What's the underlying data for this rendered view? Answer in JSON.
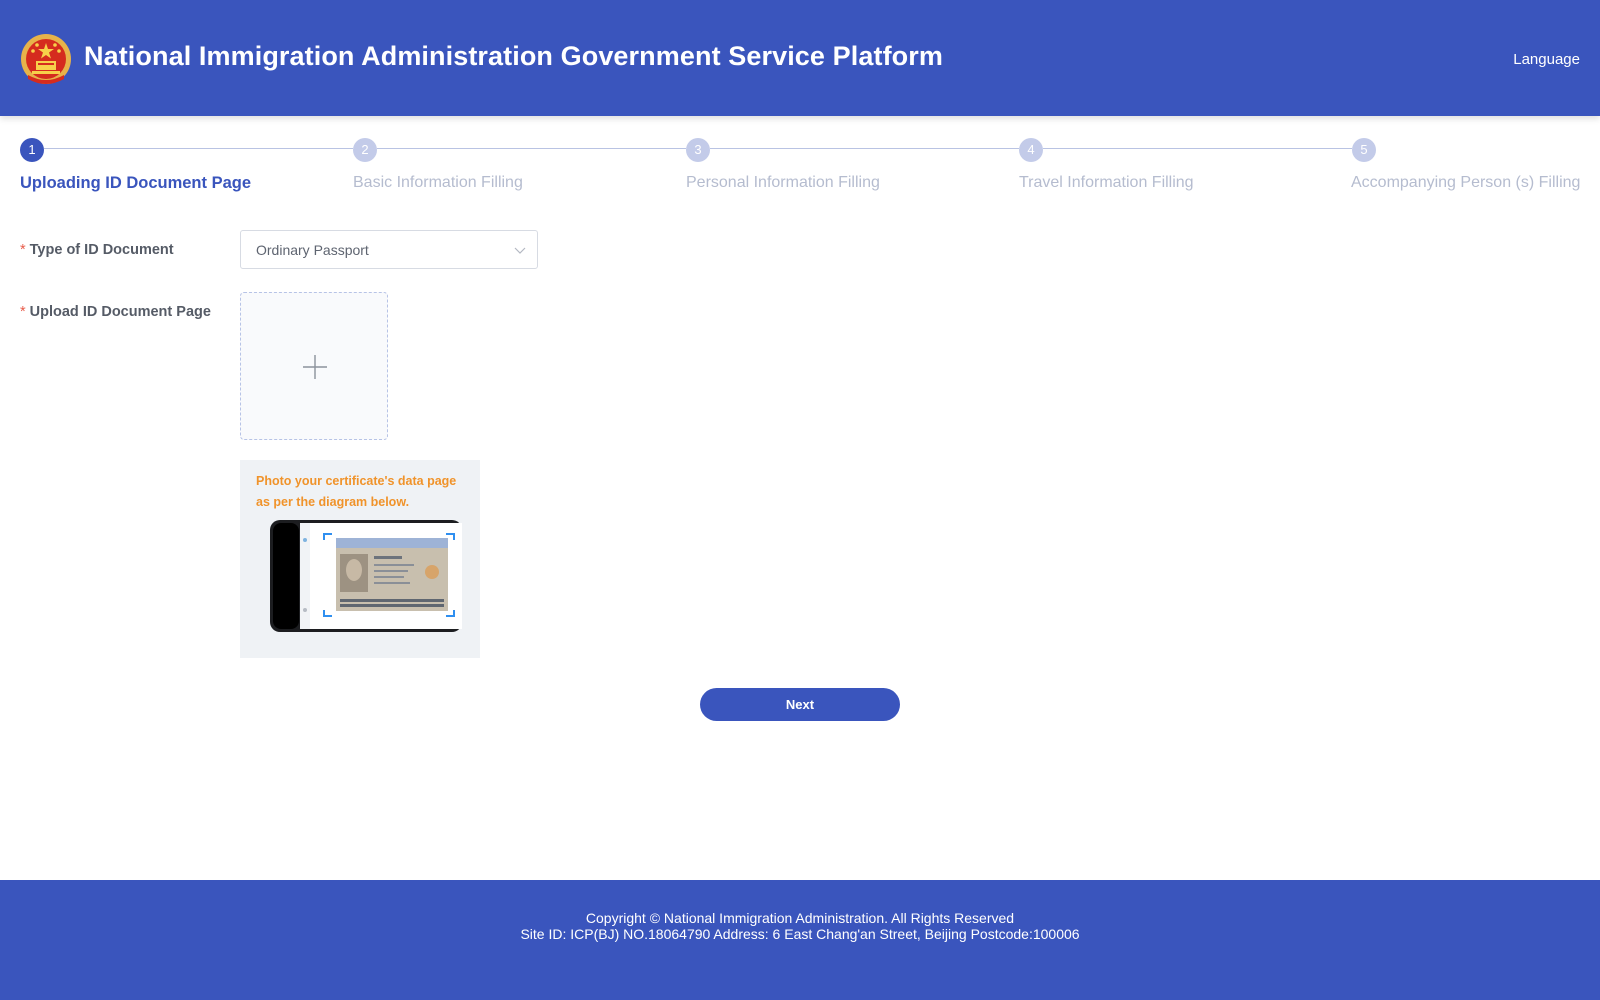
{
  "header": {
    "title": "National Immigration Administration Government Service Platform",
    "language_label": "Language"
  },
  "steps": [
    {
      "number": "1",
      "label": "Uploading ID Document Page",
      "state": "active"
    },
    {
      "number": "2",
      "label": "Basic Information Filling",
      "state": "inactive"
    },
    {
      "number": "3",
      "label": "Personal Information Filling",
      "state": "inactive"
    },
    {
      "number": "4",
      "label": "Travel Information Filling",
      "state": "inactive"
    },
    {
      "number": "5",
      "label": "Accompanying Person (s) Filling",
      "state": "inactive"
    }
  ],
  "form": {
    "required_mark": "*",
    "id_type_label": "Type of ID Document",
    "id_type_value": "Ordinary Passport",
    "upload_label": "Upload ID Document Page",
    "hint": "Photo your certificate's data page as per the diagram below."
  },
  "actions": {
    "next_label": "Next"
  },
  "footer": {
    "line1": "Copyright © National Immigration Administration. All Rights Reserved",
    "line2": "Site ID: ICP(BJ) NO.18064790 Address: 6 East Chang'an Street, Beijing Postcode:100006"
  },
  "colors": {
    "primary": "#3a55bd",
    "hint": "#f0932a",
    "required": "#e85c4a",
    "step_inactive": "#c3cbe9"
  },
  "icons": [
    "national-emblem-icon",
    "chevron-down-icon",
    "plus-icon"
  ]
}
